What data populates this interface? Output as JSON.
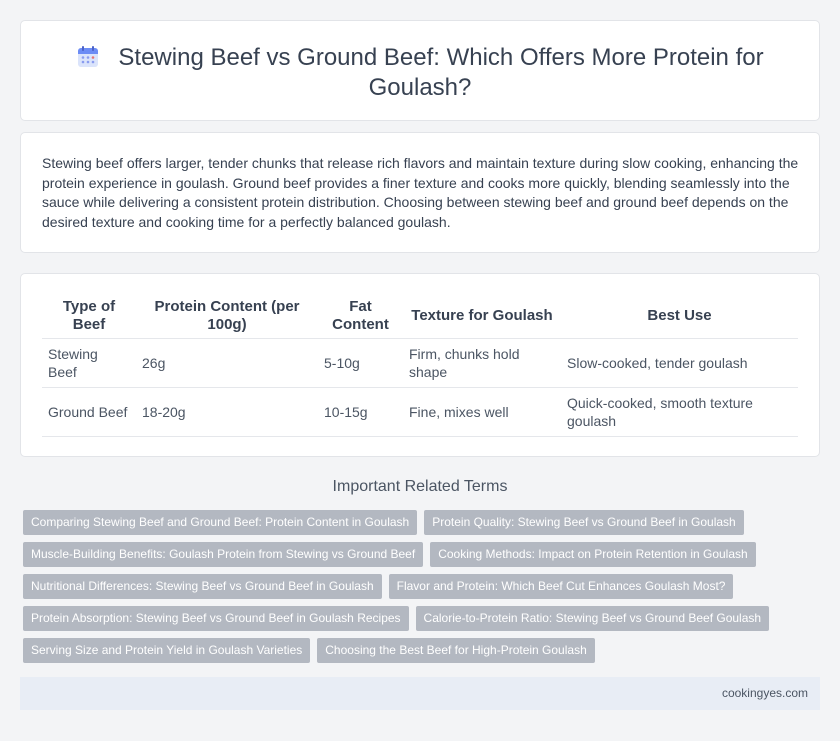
{
  "header": {
    "icon": "calendar-icon",
    "title": "Stewing Beef vs Ground Beef: Which Offers More Protein for Goulash?"
  },
  "intro": {
    "text": "Stewing beef offers larger, tender chunks that release rich flavors and maintain texture during slow cooking, enhancing the protein experience in goulash. Ground beef provides a finer texture and cooks more quickly, blending seamlessly into the sauce while delivering a consistent protein distribution. Choosing between stewing beef and ground beef depends on the desired texture and cooking time for a perfectly balanced goulash."
  },
  "table": {
    "headers": [
      "Type of Beef",
      "Protein Content (per 100g)",
      "Fat Content",
      "Texture for Goulash",
      "Best Use"
    ],
    "rows": [
      [
        "Stewing Beef",
        "26g",
        "5-10g",
        "Firm, chunks hold shape",
        "Slow-cooked, tender goulash"
      ],
      [
        "Ground Beef",
        "18-20g",
        "10-15g",
        "Fine, mixes well",
        "Quick-cooked, smooth texture goulash"
      ]
    ]
  },
  "related": {
    "title": "Important Related Terms",
    "rows": [
      [
        "Comparing Stewing Beef and Ground Beef: Protein Content in Goulash",
        "Protein Quality: Stewing Beef vs Ground Beef in Goulash"
      ],
      [
        "Muscle-Building Benefits: Goulash Protein from Stewing vs Ground Beef",
        "Cooking Methods: Impact on Protein Retention in Goulash"
      ],
      [
        "Nutritional Differences: Stewing Beef vs Ground Beef in Goulash",
        "Flavor and Protein: Which Beef Cut Enhances Goulash Most?"
      ],
      [
        "Protein Absorption: Stewing Beef vs Ground Beef in Goulash Recipes",
        "Calorie-to-Protein Ratio: Stewing Beef vs Ground Beef Goulash"
      ],
      [
        "Serving Size and Protein Yield in Goulash Varieties",
        "Choosing the Best Beef for High-Protein Goulash"
      ]
    ]
  },
  "footer": {
    "site": "cookingyes.com"
  }
}
